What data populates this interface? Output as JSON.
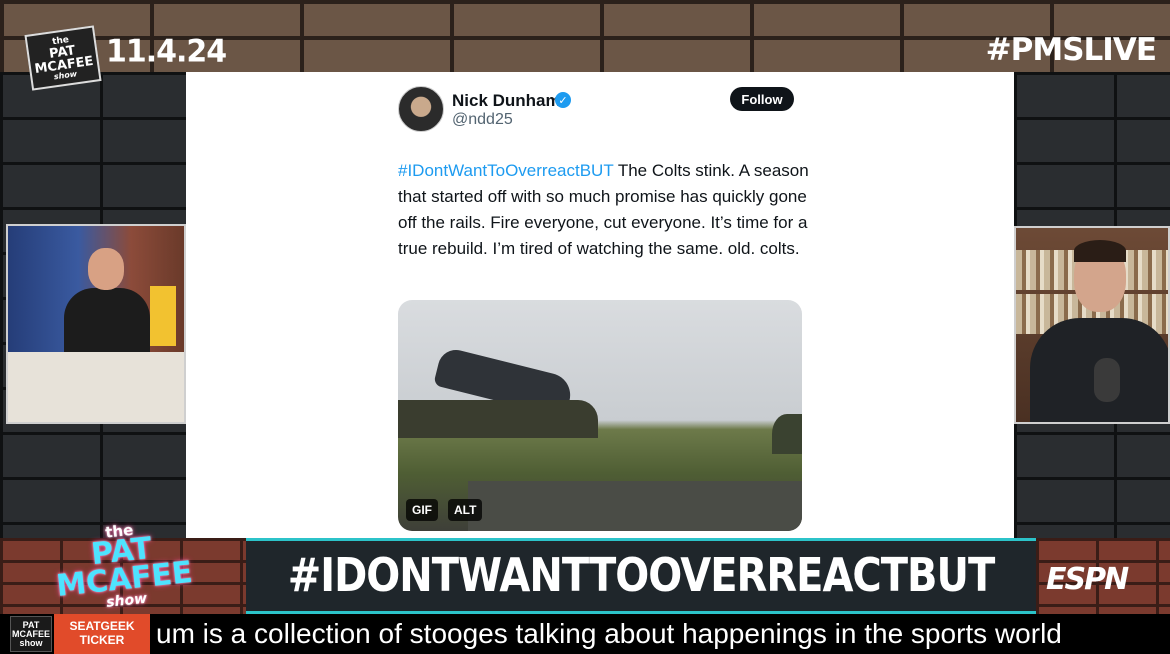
{
  "overlay": {
    "show_logo_small": {
      "line1": "the",
      "line2": "PAT",
      "line3": "MCAFEE",
      "line4": "show"
    },
    "date": "11.4.24",
    "hashtag": "#PMSLIVE"
  },
  "tweet": {
    "author_name": "Nick Dunham",
    "author_handle": "@ndd25",
    "follow_label": "Follow",
    "hashtag": "#IDontWantToOverreactBUT",
    "body": " The Colts stink. A season that started off with so much promise has quickly gone off the rails. Fire everyone, cut everyone. It’s time for a true rebuild. I’m tired of watching the same. old. colts.",
    "media_badges": [
      "GIF",
      "ALT"
    ],
    "verified_glyph": "✓"
  },
  "lower_third": {
    "headline": "#IDONTWANTTOOVERREACTBUT",
    "network": "ESPN",
    "show_logo_big": {
      "line1": "the",
      "line2": "PAT",
      "line3": "MCAFEE",
      "line4": "show"
    }
  },
  "ticker": {
    "logo": {
      "line1": "PAT",
      "line2": "MCAFEE",
      "line3": "show"
    },
    "sponsor_line1": "SEATGEEK",
    "sponsor_line2": "TICKER",
    "text": "um is a collection of stooges talking about happenings in the sports world"
  },
  "colors": {
    "accent_teal": "#2cc3c9",
    "twitter_blue": "#1d9bf0",
    "sponsor_orange": "#e14b2a"
  }
}
